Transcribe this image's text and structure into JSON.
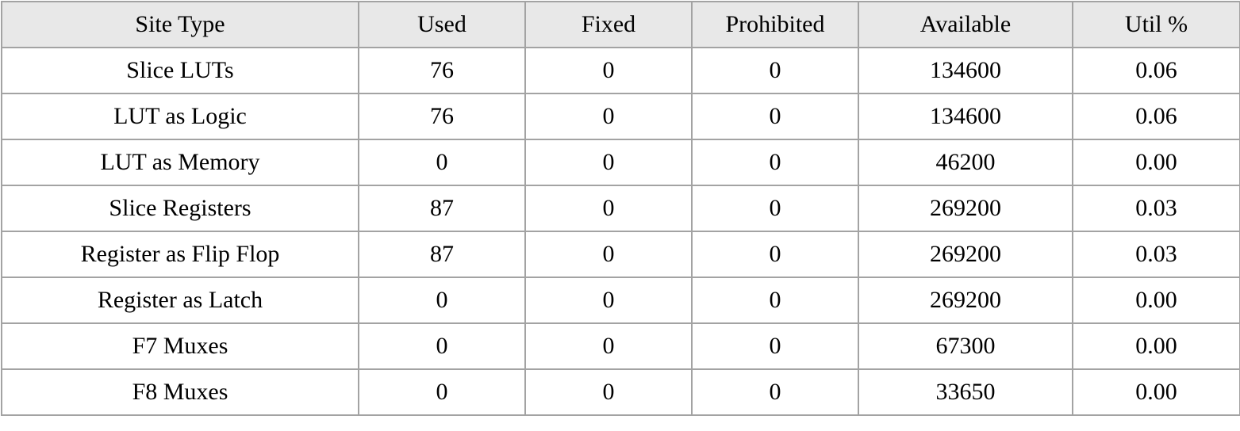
{
  "table": {
    "headers": [
      "Site Type",
      "Used",
      "Fixed",
      "Prohibited",
      "Available",
      "Util %"
    ],
    "rows": [
      [
        "Slice LUTs",
        "76",
        "0",
        "0",
        "134600",
        "0.06"
      ],
      [
        "LUT as Logic",
        "76",
        "0",
        "0",
        "134600",
        "0.06"
      ],
      [
        "LUT as Memory",
        "0",
        "0",
        "0",
        "46200",
        "0.00"
      ],
      [
        "Slice Registers",
        "87",
        "0",
        "0",
        "269200",
        "0.03"
      ],
      [
        "Register as Flip Flop",
        "87",
        "0",
        "0",
        "269200",
        "0.03"
      ],
      [
        "Register as Latch",
        "0",
        "0",
        "0",
        "269200",
        "0.00"
      ],
      [
        "F7 Muxes",
        "0",
        "0",
        "0",
        "67300",
        "0.00"
      ],
      [
        "F8 Muxes",
        "0",
        "0",
        "0",
        "33650",
        "0.00"
      ]
    ]
  }
}
